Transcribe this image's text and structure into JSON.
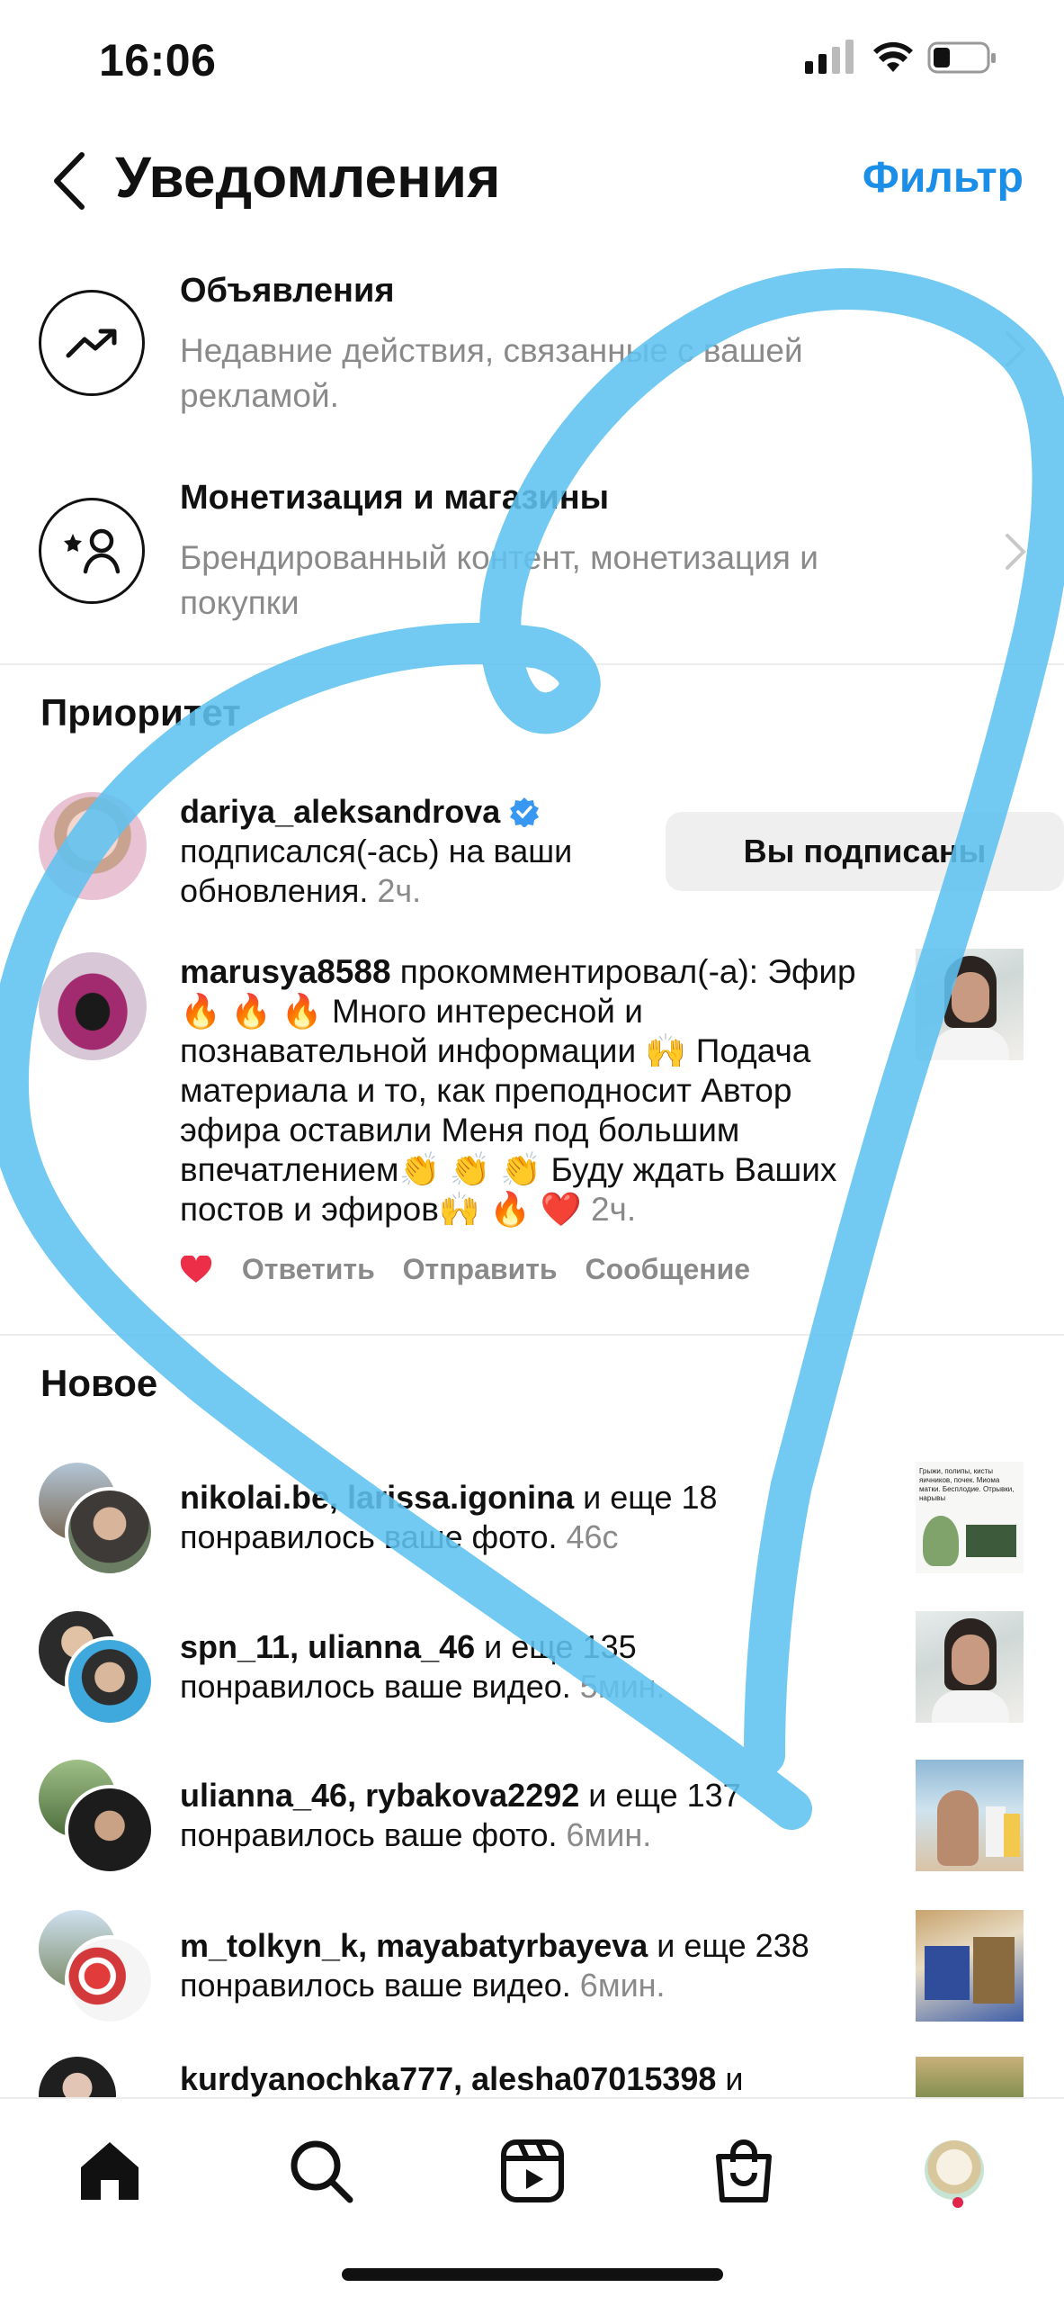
{
  "status_bar": {
    "time": "16:06"
  },
  "header": {
    "title": "Уведомления",
    "filter_label": "Фильтр"
  },
  "top_rows": [
    {
      "title": "Объявления",
      "subtitle": "Недавние действия, связанные с вашей рекламой."
    },
    {
      "title": "Монетизация и магазины",
      "subtitle": "Брендированный контент, монетизация и покупки"
    }
  ],
  "priority": {
    "section_title": "Приоритет",
    "follow": {
      "username": "dariya_aleksandrova",
      "text": " подписался(-ась) на ваши обновления.",
      "time": " 2ч.",
      "button_label": "Вы подписаны"
    },
    "comment": {
      "username": "marusya8588",
      "text": " прокомментировал(-а): Эфир🔥 🔥 🔥 Много интересной и познавательной информации 🙌 Подача материала  и то, как преподносит Автор эфира оставили Меня под большим впечатлением👏 👏 👏 Буду ждать Ваших постов и эфиров🙌 🔥 ❤️",
      "time": " 2ч.",
      "actions": [
        "Ответить",
        "Отправить",
        "Сообщение"
      ]
    }
  },
  "new": {
    "section_title": "Новое",
    "items": [
      {
        "users": "nikolai.be, larissa.igonina",
        "more": " и еще 18",
        "text": "понравилось ваше фото.",
        "time": " 46с"
      },
      {
        "users": "spn_11, ulianna_46",
        "more": " и еще 135",
        "text": "понравилось ваше видео.",
        "time": " 5мин."
      },
      {
        "users": "ulianna_46, rybakova2292",
        "more": " и еще 137",
        "text": "понравилось ваше фото.",
        "time": " 6мин."
      },
      {
        "users": "m_tolkyn_k, mayabatyrbayeva",
        "more": " и еще 238",
        "text": "понравилось ваше видео.",
        "time": " 6мин."
      },
      {
        "users": "kurdyanochka777, alesha07015398",
        "more": " и",
        "text": "",
        "time": ""
      }
    ]
  },
  "thumb1_text": "Грыжи, полипы, кисты яичников, почек. Миома матки. Бесплодие. Отрывки, нарывы",
  "colors": {
    "accent": "#1b8fe8",
    "scribble": "#5ec1f0",
    "like": "#ed2e48"
  }
}
